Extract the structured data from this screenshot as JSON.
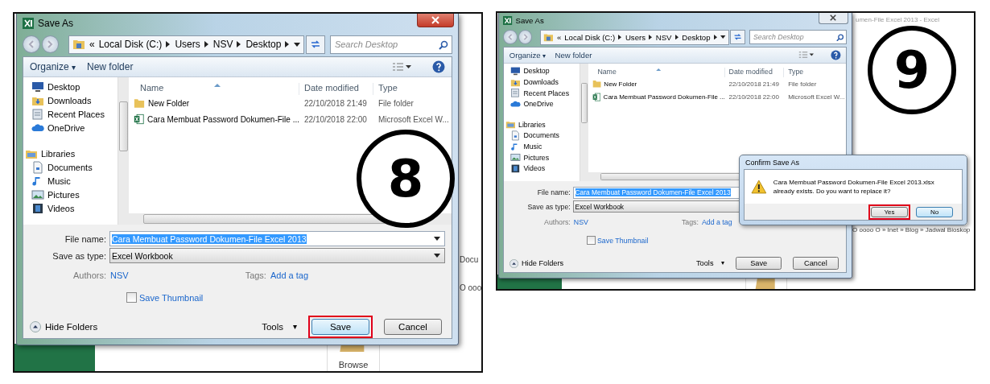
{
  "panels": [
    {
      "step": "8",
      "background": {
        "texts": [
          "Docu",
          "O ooo"
        ],
        "tile_label": "Browse"
      },
      "dialog": {
        "title": "Save As",
        "close_hot": true,
        "path_overflow": "«",
        "path": [
          "Local Disk (C:)",
          "Users",
          "NSV",
          "Desktop"
        ],
        "search": {
          "placeholder": "Search Desktop"
        },
        "toolbar": [
          "Organize",
          "New folder"
        ],
        "nav": [
          {
            "label": "Desktop",
            "kind": "desktop"
          },
          {
            "label": "Downloads",
            "kind": "downloads"
          },
          {
            "label": "Recent Places",
            "kind": "recent"
          },
          {
            "label": "OneDrive",
            "kind": "cloud"
          },
          {
            "label": "Libraries",
            "kind": "library",
            "children": [
              {
                "label": "Documents",
                "kind": "documents"
              },
              {
                "label": "Music",
                "kind": "music"
              },
              {
                "label": "Pictures",
                "kind": "pictures"
              },
              {
                "label": "Videos",
                "kind": "videos"
              }
            ]
          }
        ],
        "columns": [
          {
            "label": "Name",
            "sorted": true
          },
          {
            "label": "Date modified",
            "sorted": false
          },
          {
            "label": "Type",
            "sorted": false
          }
        ],
        "rows": [
          {
            "kind": "folder",
            "name": "New Folder",
            "date": "22/10/2018 21:49",
            "type": "File folder"
          },
          {
            "kind": "excel",
            "name": "Cara Membuat Password Dokumen-File ...",
            "date": "22/10/2018 22:00",
            "type": "Microsoft Excel W..."
          }
        ],
        "file_name": {
          "label": "File name:",
          "value": "Cara Membuat Password Dokumen-File Excel 2013",
          "selected": true
        },
        "save_type": {
          "label": "Save as type:",
          "value": "Excel Workbook"
        },
        "authors": {
          "label": "Authors:",
          "value": "NSV"
        },
        "tags": {
          "label": "Tags:",
          "value": "Add a tag"
        },
        "thumbnail": {
          "label": "Save Thumbnail",
          "checked": false
        },
        "hide_folders": "Hide Folders",
        "tools": "Tools",
        "buttons": [
          {
            "label": "Save",
            "default": true,
            "highlighted": true
          },
          {
            "label": "Cancel",
            "default": false,
            "highlighted": false
          }
        ]
      },
      "toolbar_caret": "▾",
      "tools_caret": "▾"
    },
    {
      "step": "9",
      "background": {
        "title": "umen-File Excel 2013 - Excel",
        "texts": [
          "O oooo O » Inet » Blog » Jadwal Bioskop"
        ]
      },
      "dialog": {
        "title": "Save As",
        "close_hot": false,
        "path_overflow": "«",
        "path": [
          "Local Disk (C:)",
          "Users",
          "NSV",
          "Desktop"
        ],
        "search": {
          "placeholder": "Search Desktop"
        },
        "toolbar": [
          "Organize",
          "New folder"
        ],
        "nav": [
          {
            "label": "Desktop",
            "kind": "desktop"
          },
          {
            "label": "Downloads",
            "kind": "downloads"
          },
          {
            "label": "Recent Places",
            "kind": "recent"
          },
          {
            "label": "OneDrive",
            "kind": "cloud"
          },
          {
            "label": "Libraries",
            "kind": "library",
            "children": [
              {
                "label": "Documents",
                "kind": "documents"
              },
              {
                "label": "Music",
                "kind": "music"
              },
              {
                "label": "Pictures",
                "kind": "pictures"
              },
              {
                "label": "Videos",
                "kind": "videos"
              }
            ]
          }
        ],
        "columns": [
          {
            "label": "Name",
            "sorted": true
          },
          {
            "label": "Date modified",
            "sorted": false
          },
          {
            "label": "Type",
            "sorted": false
          }
        ],
        "rows": [
          {
            "kind": "folder",
            "name": "New Folder",
            "date": "22/10/2018 21:49",
            "type": "File folder"
          },
          {
            "kind": "excel",
            "name": "Cara Membuat Password Dokumen-File ...",
            "date": "22/10/2018 22:00",
            "type": "Microsoft Excel W..."
          }
        ],
        "file_name": {
          "label": "File name:",
          "value": "Cara Membuat Password Dokumen-File Excel 2013",
          "selected": true
        },
        "save_type": {
          "label": "Save as type:",
          "value": "Excel Workbook"
        },
        "authors": {
          "label": "Authors:",
          "value": "NSV"
        },
        "tags": {
          "label": "Tags:",
          "value": "Add a tag"
        },
        "thumbnail": {
          "label": "Save Thumbnail",
          "checked": false
        },
        "hide_folders": "Hide Folders",
        "tools": "Tools",
        "buttons": [
          {
            "label": "Save",
            "default": false,
            "highlighted": false
          },
          {
            "label": "Cancel",
            "default": false,
            "highlighted": false
          }
        ]
      },
      "toolbar_caret": "▾",
      "tools_caret": "▾",
      "confirm": {
        "title": "Confirm Save As",
        "message": "Cara Membuat Password Dokumen-File Excel 2013.xlsx already exists. Do you want to replace it?",
        "buttons": [
          {
            "label": "Yes",
            "default": false,
            "highlighted": true
          },
          {
            "label": "No",
            "default": true,
            "highlighted": false
          }
        ]
      }
    }
  ]
}
